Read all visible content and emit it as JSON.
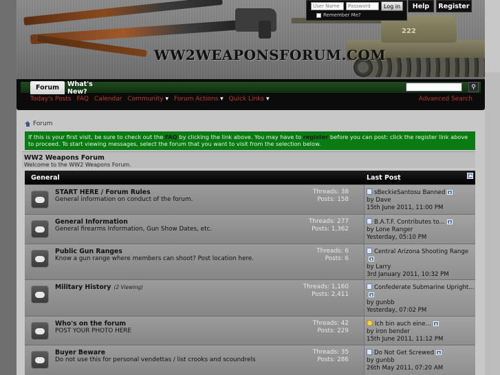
{
  "header": {
    "site_title": "WW2WEAPONSFORUM.COM",
    "tank_number": "222"
  },
  "login": {
    "username_placeholder": "User Name",
    "password_placeholder": "Password",
    "login_button": "Log in",
    "remember_label": "Remember Me?"
  },
  "header_buttons": {
    "help": "Help",
    "register": "Register"
  },
  "navbar": {
    "tabs": [
      {
        "label": "Forum"
      },
      {
        "label": "What's New?"
      }
    ],
    "sub_links": [
      {
        "label": "Today's Posts"
      },
      {
        "label": "FAQ"
      },
      {
        "label": "Calendar"
      },
      {
        "label": "Community"
      },
      {
        "label": "Forum Actions"
      },
      {
        "label": "Quick Links"
      }
    ],
    "advanced_search": "Advanced Search"
  },
  "breadcrumb": {
    "label": "Forum"
  },
  "notice": {
    "part1": "If this is your first visit, be sure to check out the ",
    "faq": "FAQ",
    "part2": " by clicking the link above. You may have to ",
    "register": "register",
    "part3": " before you can post: click the register link above to proceed. To start viewing messages, select the forum that you want to visit from the selection below."
  },
  "forum_title": {
    "title": "WW2 Weapons Forum",
    "description": "Welcome to the WW2 Weapons Forum."
  },
  "table": {
    "header_left": "General",
    "header_right": "Last Post",
    "forums": [
      {
        "name": "START HERE / Forum Rules",
        "viewing": "",
        "description": "General information on conduct of the forum.",
        "threads": "Threads: 38",
        "posts": "Posts: 158",
        "last_title": "sBeckieSantosu Banned",
        "last_by": "Dave",
        "last_date": "15th June 2011, 11:00 PM",
        "icon": "post"
      },
      {
        "name": "General Information",
        "viewing": "",
        "description": "General firearms Information, Gun Show Dates, etc.",
        "threads": "Threads: 277",
        "posts": "Posts: 1,362",
        "last_title": "B.A.T.F. Contributes to...",
        "last_by": "Lone Ranger",
        "last_date": "Yesterday, 05:10 PM",
        "icon": "post"
      },
      {
        "name": "Public Gun Ranges",
        "viewing": "",
        "description": "Know a gun range where members can shoot? Post location here.",
        "threads": "Threads: 6",
        "posts": "Posts: 6",
        "last_title": "Central Arizona Shooting Range",
        "last_by": "Larry",
        "last_date": "3rd January 2011, 10:32 PM",
        "icon": "post"
      },
      {
        "name": "Military History",
        "viewing": "(2 Viewing)",
        "description": "",
        "threads": "Threads: 1,160",
        "posts": "Posts: 2,411",
        "last_title": "Confederate Submarine Upright...",
        "last_by": "gunbb",
        "last_date": "Yesterday, 07:02 PM",
        "icon": "post"
      },
      {
        "name": "Who's on the forum",
        "viewing": "",
        "description": "POST YOUR PHOTO HERE",
        "threads": "Threads: 42",
        "posts": "Posts: 229",
        "last_title": "Ich bin auch eine...",
        "last_by": "iron bender",
        "last_date": "15th June 2011, 11:12 PM",
        "icon": "smile"
      },
      {
        "name": "Buyer Beware",
        "viewing": "",
        "description": "Do not use this for personal vendettas / list crooks and scoundrels",
        "threads": "Threads: 35",
        "posts": "Posts: 286",
        "last_title": "Do Not Get Screwed",
        "last_by": "gunbb",
        "last_date": "26th May 2011, 07:20 AM",
        "icon": "post"
      }
    ],
    "by_prefix": "by "
  },
  "colors": {
    "nav_bg": "#0b0b0b",
    "notice_bg": "#0a7a12",
    "link_red": "#c0392b",
    "table_header": "#000000"
  }
}
